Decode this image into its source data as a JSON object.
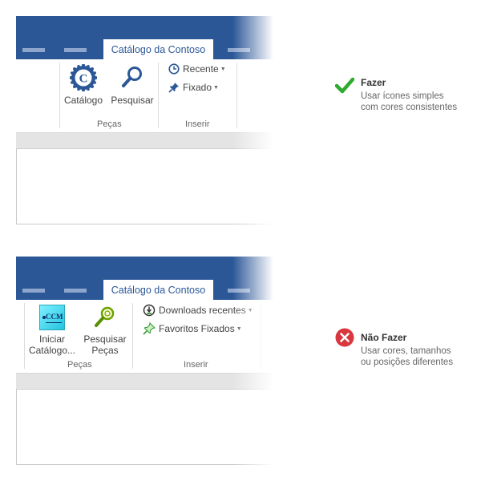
{
  "do_example": {
    "tab_label": "Catálogo da Contoso",
    "group_pecas_label": "Peças",
    "group_inserir_label": "Inserir",
    "catalog_button_label": "Catálogo",
    "search_button_label": "Pesquisar",
    "recent_button_label": "Recente",
    "pinned_button_label": "Fixado",
    "icon_color": "#2b5797"
  },
  "dont_example": {
    "tab_label": "Catálogo da Contoso",
    "group_pecas_label": "Peças",
    "group_inserir_label": "Inserir",
    "start_catalog_label_line1": "Iniciar",
    "start_catalog_label_line2": "Catálogo...",
    "start_catalog_icon_text": "CCM",
    "search_parts_label_line1": "Pesquisar",
    "search_parts_label_line2": "Peças",
    "recent_downloads_label": "Downloads recentes",
    "pinned_favorites_label": "Favoritos Fixados"
  },
  "guidance": {
    "do": {
      "heading": "Fazer",
      "line1": "Usar ícones simples",
      "line2": "com cores consistentes",
      "color": "#2eaa2e"
    },
    "dont": {
      "heading": "Não Fazer",
      "line1": "Usar cores, tamanhos",
      "line2": "ou posições diferentes",
      "color": "#d9363e"
    }
  },
  "colors": {
    "title_bar": "#2b5797",
    "status_bar": "#e4e4e4"
  }
}
